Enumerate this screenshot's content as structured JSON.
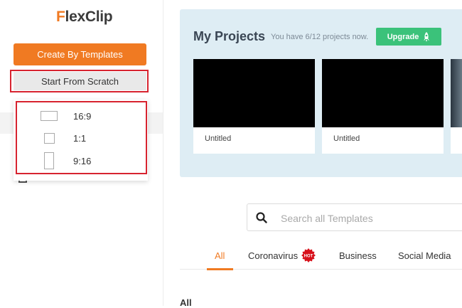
{
  "brand": {
    "logo_first_letter": "F",
    "logo_rest": "lexClip"
  },
  "sidebar": {
    "create_by_templates_label": "Create By Templates",
    "start_from_scratch_label": "Start From Scratch",
    "ratios": [
      {
        "label": "16:9"
      },
      {
        "label": "1:1"
      },
      {
        "label": "9:16"
      }
    ]
  },
  "projects": {
    "title": "My Projects",
    "count_text": "You have 6/12 projects now.",
    "upgrade_label": "Upgrade",
    "cards": [
      {
        "name": "Untitled"
      },
      {
        "name": "Untitled"
      }
    ]
  },
  "search": {
    "placeholder": "Search all Templates"
  },
  "tabs": [
    {
      "label": "All"
    },
    {
      "label": "Coronavirus"
    },
    {
      "label": "Business"
    },
    {
      "label": "Social Media"
    }
  ],
  "hot_badge_text": "HOT",
  "section_title": "All",
  "colors": {
    "brand_orange": "#f07a22",
    "upgrade_green": "#3bc27a",
    "highlight_red": "#d7232f",
    "panel_blue": "#deedf4"
  }
}
